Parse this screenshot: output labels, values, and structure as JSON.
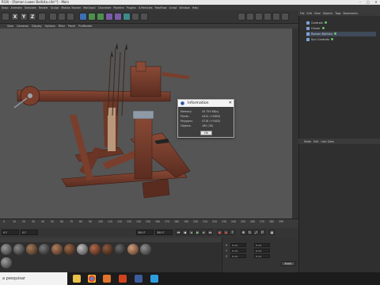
{
  "window": {
    "title": "R19) - [Roman Lower Ballista.c4d *] - Main",
    "controls": [
      "–",
      "□",
      "✕"
    ]
  },
  "menubar": [
    "Snap",
    "Animate",
    "Simulate",
    "Render",
    "Sculpt",
    "Motion Tracker",
    "MoGraph",
    "Character",
    "Pipeline",
    "Plugins",
    "X-Particles",
    "RealFlow",
    "Script",
    "Window",
    "Help"
  ],
  "toolbar": {
    "axis_buttons": [
      "X",
      "Y",
      "Z"
    ]
  },
  "viewport_menu": [
    "View",
    "Cameras",
    "Display",
    "Options",
    "Filter",
    "Panel",
    "ProRender"
  ],
  "object_manager": {
    "menu": [
      "File",
      "Edit",
      "View",
      "Objects",
      "Tags",
      "Bookmarks"
    ],
    "objects": [
      {
        "name": "Controls"
      },
      {
        "name": "Cloner"
      },
      {
        "name": "Roman Ballista"
      },
      {
        "name": "Sun Controls"
      }
    ]
  },
  "attribute_manager": {
    "menu": [
      "Mode",
      "Edit",
      "User Data"
    ]
  },
  "timeline": {
    "ticks": [
      "0",
      "10",
      "20",
      "30",
      "40",
      "50",
      "60",
      "70",
      "80",
      "90",
      "100",
      "110",
      "120",
      "130",
      "140",
      "150",
      "160",
      "170",
      "180",
      "190",
      "200",
      "210",
      "220",
      "230",
      "240",
      "250",
      "260",
      "270",
      "280",
      "290"
    ],
    "current_frame": "0 F",
    "start_frame": "0 F",
    "end_frame": "300 F",
    "end_frame_2": "300 F"
  },
  "coordinates": {
    "labels": [
      "X",
      "Y",
      "Z"
    ],
    "field_value": "0 cm",
    "apply_label": "Apply"
  },
  "info_dialog": {
    "title": "Information",
    "rows": [
      {
        "label": "Memory:",
        "value": "45 793 KB(s)"
      },
      {
        "label": "Points:",
        "value": "4415 (+4894)"
      },
      {
        "label": "Polygons:",
        "value": "4718 (+5405)"
      },
      {
        "label": "Objects:",
        "value": "165 (30)"
      }
    ],
    "ok_label": "Ok"
  },
  "taskbar": {
    "search_placeholder": "a pesquisar"
  },
  "colors": {
    "viewport_bg": "#555555",
    "wood_dark": "#5a2c20",
    "wood_light": "#8a4a36",
    "accent_blue": "#3c6fb4"
  }
}
